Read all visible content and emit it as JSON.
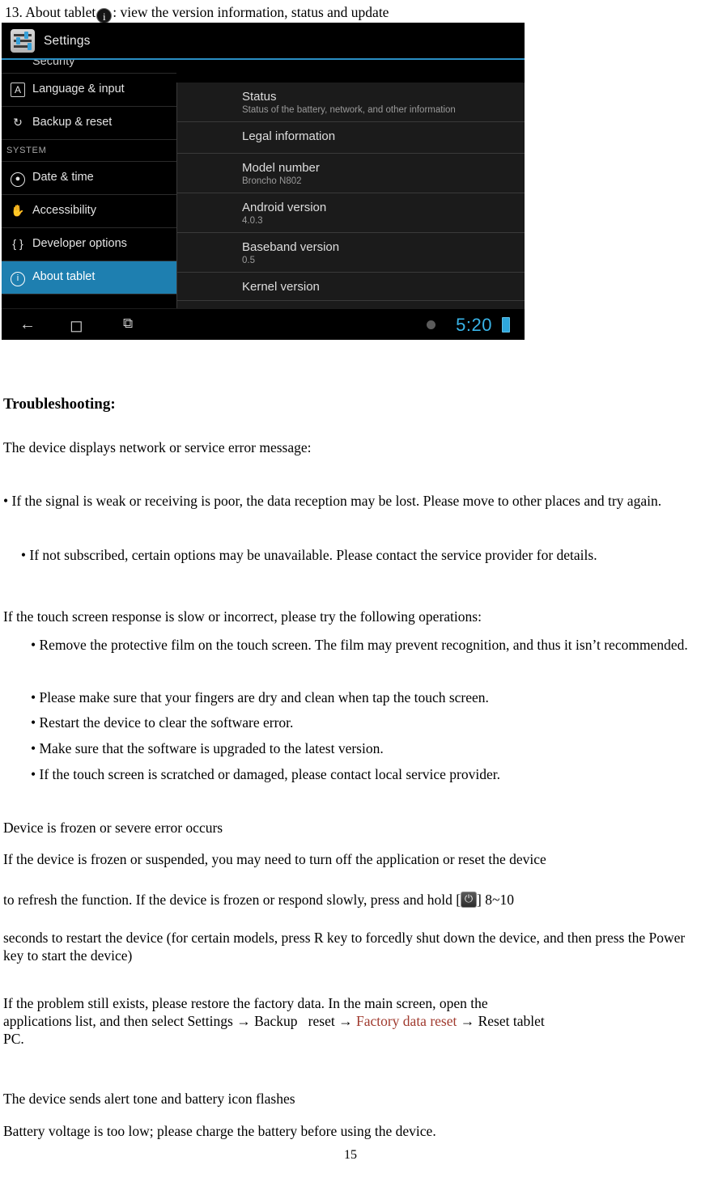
{
  "doc": {
    "intro_prefix": "13. About tablet",
    "intro_icon": "info-icon",
    "intro_suffix": ": view the version information, status and update",
    "troubleshooting_heading": "Troubleshooting:",
    "paragraphs": {
      "network_error": "The device displays network or service error message:",
      "signal_weak": "• If the signal is weak or receiving is poor, the data reception may be lost. Please move to other places and try again.",
      "not_subscribed": "• If not subscribed, certain options may be unavailable. Please contact the service provider for details.",
      "touch_slow": "If the touch screen response is slow or incorrect, please try the following operations:",
      "remove_film": "• Remove the protective film on the touch screen. The film may prevent recognition, and thus it isn’t recommended.",
      "dry_fingers": "• Please make sure that your fingers are dry and clean when tap the touch screen.",
      "restart_device": "• Restart the device to clear the software error.",
      "upgrade_software": "• Make sure that the software is upgraded to the latest version.",
      "scratched": "• If the touch screen is scratched or damaged, please contact local service provider.",
      "frozen_heading": "Device is frozen or severe error occurs",
      "frozen_1": "If the device is frozen or suspended, you may need to turn off the application or reset the device",
      "frozen_2a": "to refresh the function. If the device is frozen or respond slowly, press and hold [",
      "frozen_2b": "] 8~10",
      "frozen_3": "seconds to restart the device (for certain models, press R key to forcedly shut down the device, and then press the Power key to start the device)",
      "restore_a": "If the problem still exists, please restore the factory data. In the main screen, open the",
      "restore_b": "applications list, and then select Settings → Backup   reset → ",
      "restore_link": "Factory data reset",
      "restore_c": " → Reset tablet",
      "restore_d": "PC.",
      "alert_tone": "The device sends alert tone and battery icon flashes",
      "battery_low": "Battery voltage is too low; please charge the battery before using the device."
    },
    "page_number": "15"
  },
  "screenshot": {
    "titlebar": {
      "app_icon": "settings-icon",
      "title": "Settings"
    },
    "left_pane": {
      "partial_top_label": "Security",
      "items": [
        {
          "icon": "language-icon",
          "label": "Language & input",
          "selected": false
        },
        {
          "icon": "backup-reset-icon",
          "label": "Backup & reset",
          "selected": false
        }
      ],
      "section_label": "SYSTEM",
      "system_items": [
        {
          "icon": "clock-icon",
          "label": "Date & time",
          "selected": false
        },
        {
          "icon": "accessibility-icon",
          "label": "Accessibility",
          "selected": false
        },
        {
          "icon": "developer-options-icon",
          "label": "Developer options",
          "selected": false
        },
        {
          "icon": "info-icon",
          "label": "About tablet",
          "selected": true
        }
      ]
    },
    "right_pane": {
      "rows": [
        {
          "title": "Status",
          "sub": "Status of the battery, network, and other information"
        },
        {
          "title": "Legal information",
          "sub": ""
        },
        {
          "title": "Model number",
          "sub": "Broncho N802"
        },
        {
          "title": "Android version",
          "sub": "4.0.3"
        },
        {
          "title": "Baseband version",
          "sub": "0.5"
        },
        {
          "title": "Kernel version",
          "sub": ""
        }
      ]
    },
    "navbar": {
      "back_icon": "back-arrow-icon",
      "home_icon": "home-icon",
      "recents_icon": "recent-apps-icon",
      "notification_dot": "notification-dot-icon",
      "clock": "5:20",
      "battery_icon": "battery-icon"
    },
    "accent_color": "#1e7fb0",
    "clock_color": "#39b4e8"
  }
}
